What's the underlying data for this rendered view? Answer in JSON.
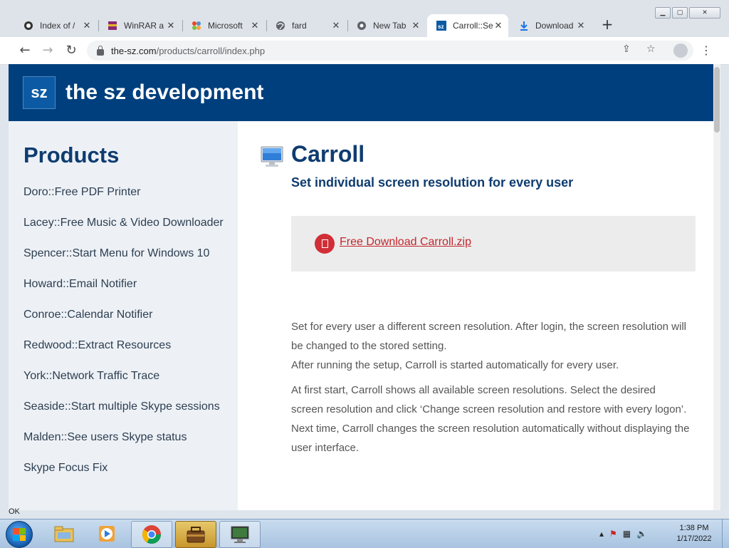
{
  "browser": {
    "tabs": [
      {
        "title": "Index of /",
        "icon": "server-icon"
      },
      {
        "title": "WinRAR a",
        "icon": "winrar-icon"
      },
      {
        "title": "Microsoft",
        "icon": "joomla-icon"
      },
      {
        "title": "fard",
        "icon": "globe-icon"
      },
      {
        "title": "New Tab",
        "icon": "chrome-icon"
      },
      {
        "title": "Carroll::Se",
        "icon": "sz-icon",
        "active": true
      },
      {
        "title": "Download",
        "icon": "download-icon"
      }
    ],
    "url_domain": "the-sz.com",
    "url_path": "/products/carroll/index.php",
    "close_glyph": "✕",
    "new_tab_glyph": "+"
  },
  "site": {
    "logo_text": "sz",
    "name": "the sz development"
  },
  "sidebar": {
    "heading": "Products",
    "items": [
      "Doro::Free PDF Printer",
      "Lacey::Free Music & Video Downloader",
      "Spencer::Start Menu for Windows 10",
      "Howard::Email Notifier",
      "Conroe::Calendar Notifier",
      "Redwood::Extract Resources",
      "York::Network Traffic Trace",
      "Seaside::Start multiple Skype sessions",
      "Malden::See users Skype status",
      "Skype Focus Fix"
    ]
  },
  "product": {
    "title": "Carroll",
    "subtitle": "Set individual screen resolution for every user",
    "download_label": "Free Download Carroll.zip",
    "description": [
      "Set for every user a different screen resolution. After login, the screen resolution will be changed to the stored setting.",
      "After running the setup, Carroll is started automatically for every user.",
      "At first start, Carroll shows all available screen resolutions. Select the desired screen resolution and click ‘Change screen resolution and restore with every logon’.",
      "Next time, Carroll changes the screen resolution automatically without displaying the user interface."
    ]
  },
  "status_text": "OK",
  "taskbar": {
    "time": "1:38 PM",
    "date": "1/17/2022",
    "apps": [
      "explorer-icon",
      "media-player-icon",
      "chrome-icon",
      "toolbox-icon",
      "monitor-app-icon"
    ]
  },
  "colors": {
    "header_bg": "#003f7d",
    "accent_title": "#0f3c70",
    "download_red": "#c2272d"
  }
}
